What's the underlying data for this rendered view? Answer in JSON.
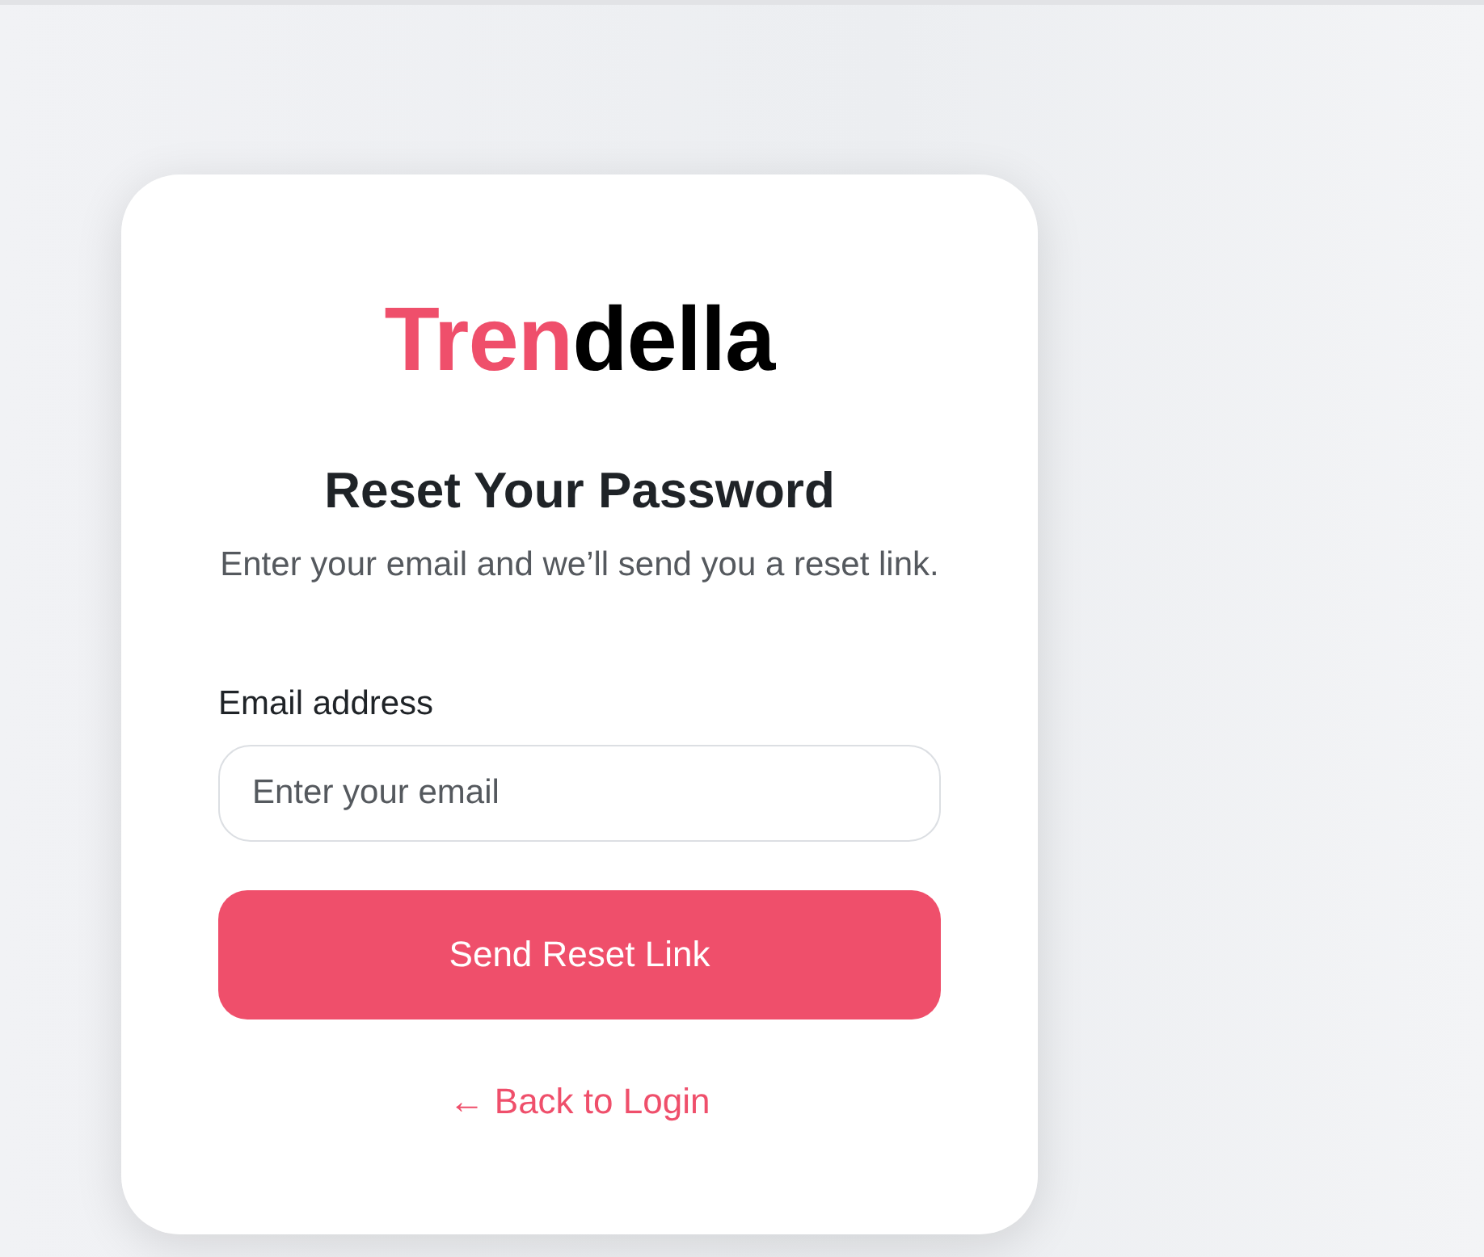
{
  "logo": {
    "accent": "Tren",
    "rest": "della"
  },
  "title": "Reset Your Password",
  "subtitle": "Enter your email and we’ll send you a reset link.",
  "email": {
    "label": "Email address",
    "placeholder": "Enter your email"
  },
  "submit": "Send Reset Link",
  "back_link": "← Back to Login"
}
